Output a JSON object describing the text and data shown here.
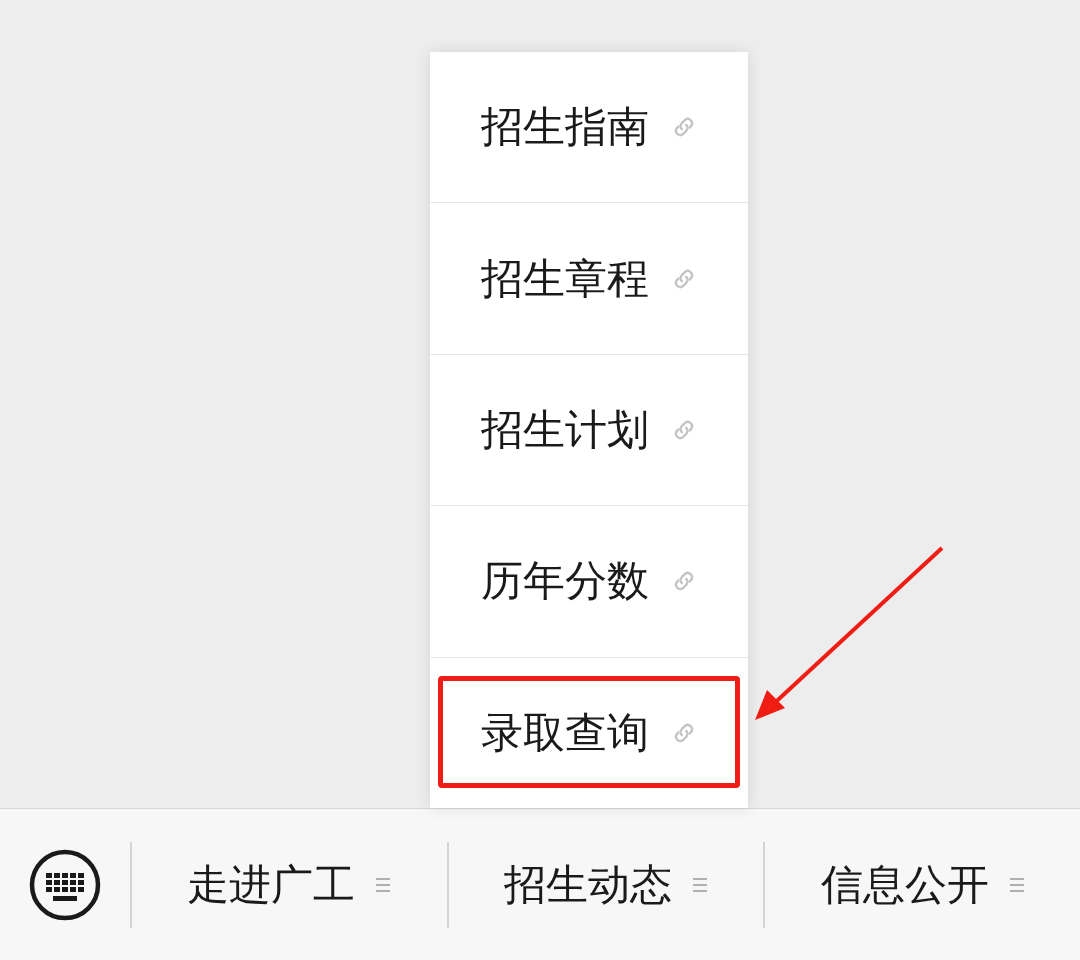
{
  "submenu": {
    "items": [
      {
        "label": "招生指南",
        "highlighted": false
      },
      {
        "label": "招生章程",
        "highlighted": false
      },
      {
        "label": "招生计划",
        "highlighted": false
      },
      {
        "label": "历年分数",
        "highlighted": false
      },
      {
        "label": "录取查询",
        "highlighted": true
      }
    ]
  },
  "menu_bar": {
    "items": [
      {
        "label": "走进广工"
      },
      {
        "label": "招生动态"
      },
      {
        "label": "信息公开"
      }
    ]
  }
}
